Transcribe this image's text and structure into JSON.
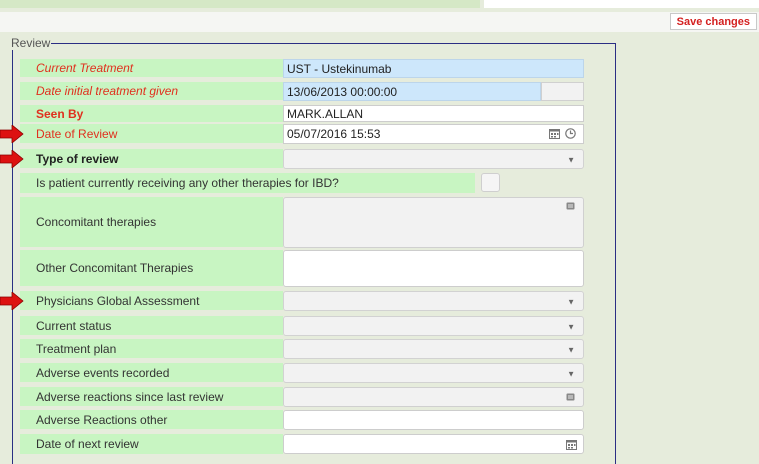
{
  "toolbar": {
    "save_label": "Save changes"
  },
  "form": {
    "legend": "Review",
    "current_treatment": {
      "label": "Current Treatment",
      "value": "UST - Ustekinumab"
    },
    "date_initial": {
      "label": "Date initial treatment given",
      "value": "13/06/2013 00:00:00"
    },
    "seen_by": {
      "label": "Seen By",
      "value": "MARK.ALLAN"
    },
    "date_review": {
      "label": "Date of Review",
      "value": "05/07/2016 15:53"
    },
    "type_review": {
      "label": "Type of review",
      "value": ""
    },
    "other_therapies": {
      "label": "Is patient currently receiving any other therapies for IBD?"
    },
    "concomitant": {
      "label": "Concomitant therapies",
      "value": ""
    },
    "other_concomitant": {
      "label": "Other Concomitant Therapies",
      "value": ""
    },
    "pga": {
      "label": "Physicians Global Assessment",
      "value": ""
    },
    "current_status": {
      "label": "Current status",
      "value": ""
    },
    "treatment_plan": {
      "label": "Treatment plan",
      "value": ""
    },
    "adverse_events": {
      "label": "Adverse events recorded",
      "value": ""
    },
    "adverse_reactions": {
      "label": "Adverse reactions since last review",
      "value": ""
    },
    "adverse_other": {
      "label": "Adverse Reactions other",
      "value": ""
    },
    "next_review": {
      "label": "Date of next review",
      "value": ""
    }
  },
  "colors": {
    "arrow": "#dd1111",
    "label_bg": "#c8f5c2",
    "blue_field": "#cde7fb",
    "fieldset_border": "#2b2e84"
  },
  "icons": [
    "calendar-icon",
    "clock-icon",
    "chevron-down-icon",
    "list-icon",
    "arrow-right-icon"
  ]
}
